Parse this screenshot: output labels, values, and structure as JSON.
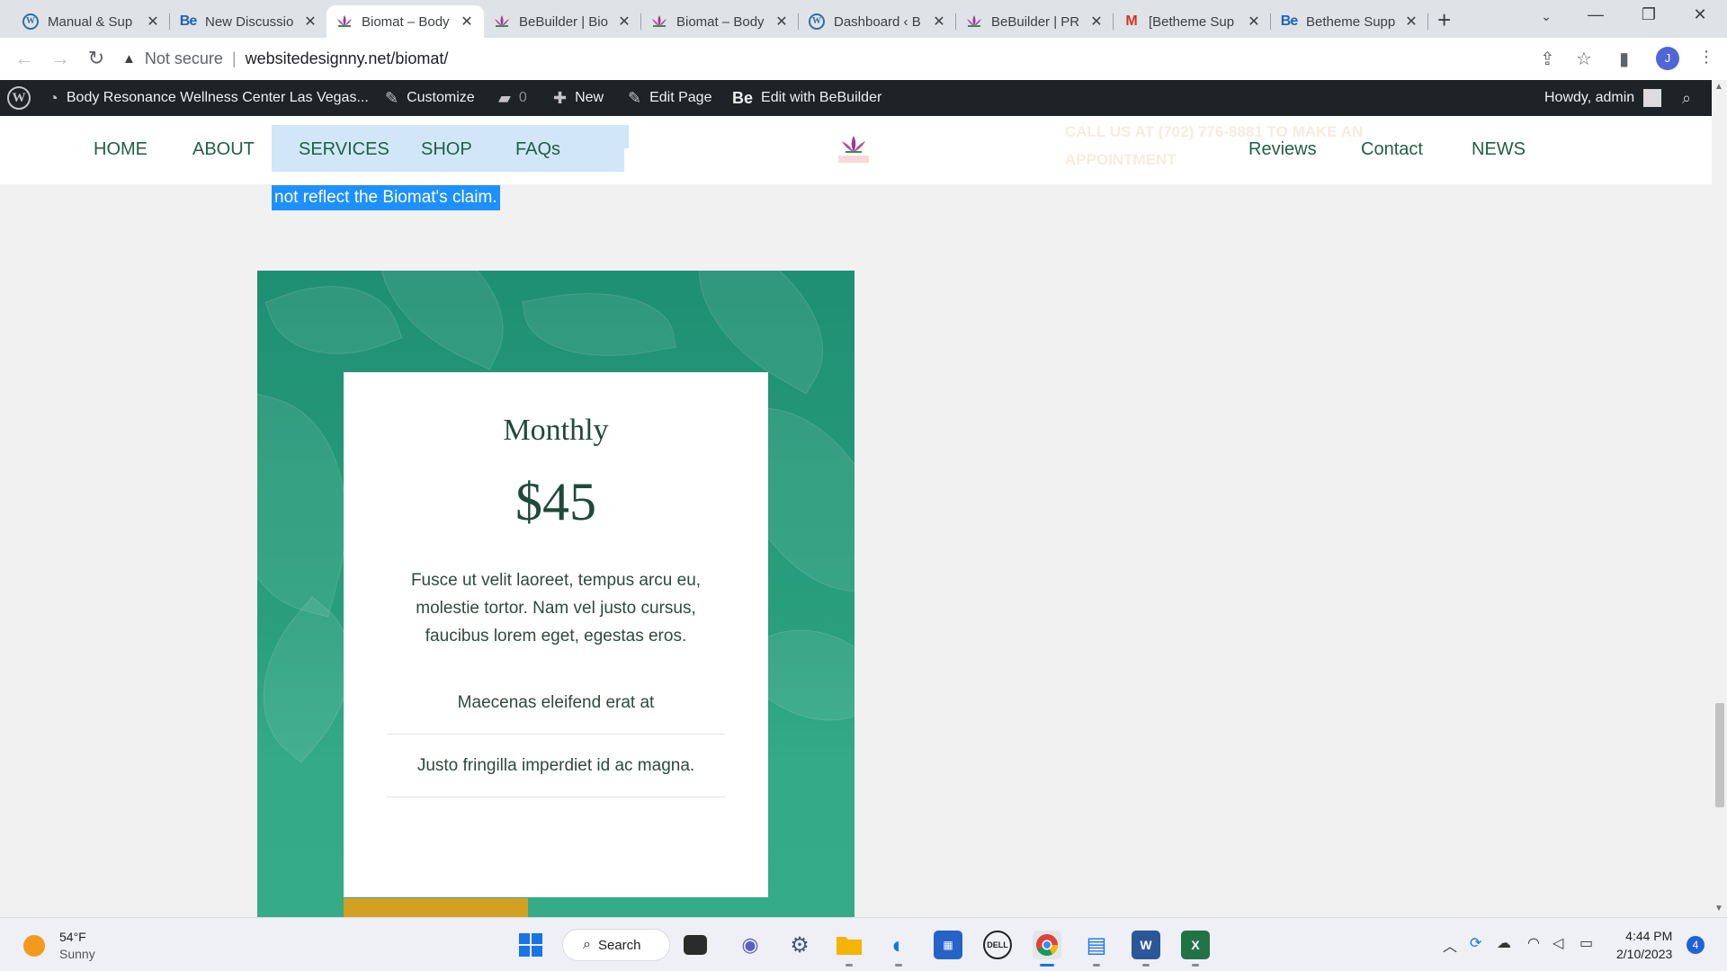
{
  "browser": {
    "tabs": [
      {
        "title": "Manual & Sup",
        "icon": "wordpress-icon",
        "active": false
      },
      {
        "title": "New Discussio",
        "icon": "bebuilder-icon",
        "active": false
      },
      {
        "title": "Biomat – Body",
        "icon": "lotus-icon",
        "active": true
      },
      {
        "title": "BeBuilder | Bio",
        "icon": "lotus-icon",
        "active": false
      },
      {
        "title": "Biomat – Body",
        "icon": "lotus-icon",
        "active": false
      },
      {
        "title": "Dashboard ‹ B",
        "icon": "wordpress-icon",
        "active": false
      },
      {
        "title": "BeBuilder | PR",
        "icon": "lotus-icon",
        "active": false
      },
      {
        "title": "[Betheme Sup",
        "icon": "gmail-icon",
        "active": false
      },
      {
        "title": "Betheme Supp",
        "icon": "bebuilder-icon",
        "active": false
      }
    ],
    "security_label": "Not secure",
    "url": "websitedesignny.net/biomat/",
    "profile_initial": "J"
  },
  "adminbar": {
    "site_name": "Body Resonance Wellness Center Las Vegas...",
    "customize": "Customize",
    "comments_count": "0",
    "new": "New",
    "edit_page": "Edit Page",
    "edit_builder_prefix": "Be",
    "edit_builder": "Edit with BeBuilder",
    "howdy": "Howdy, admin"
  },
  "site": {
    "nav_left": [
      "HOME",
      "ABOUT",
      "SERVICES",
      "SHOP",
      "FAQs"
    ],
    "nav_right": [
      "Reviews",
      "Contact",
      "NEWS"
    ],
    "ghost_cta": "CALL US AT (702) 776-8881 TO MAKE AN APPOINTMENT",
    "selected_text": "not reflect the Biomat's claim."
  },
  "pricing": {
    "title": "Monthly",
    "price": "$45",
    "description": "Fusce ut velit laoreet, tempus arcu eu, molestie tortor. Nam vel justo cursus, faucibus lorem eget, egestas eros.",
    "features": [
      "Maecenas eleifend erat at",
      "Justo fringilla imperdiet id ac magna."
    ]
  },
  "taskbar": {
    "weather_temp": "54°F",
    "weather_desc": "Sunny",
    "search_label": "Search",
    "time": "4:44 PM",
    "date": "2/10/2023",
    "notifications": "4"
  },
  "colors": {
    "brand_green": "#1f4a3a",
    "card_green": "#2a9f7d",
    "button_gold": "#d3a022",
    "selection_blue": "#1e90ff",
    "adminbar_bg": "#1d2327"
  }
}
